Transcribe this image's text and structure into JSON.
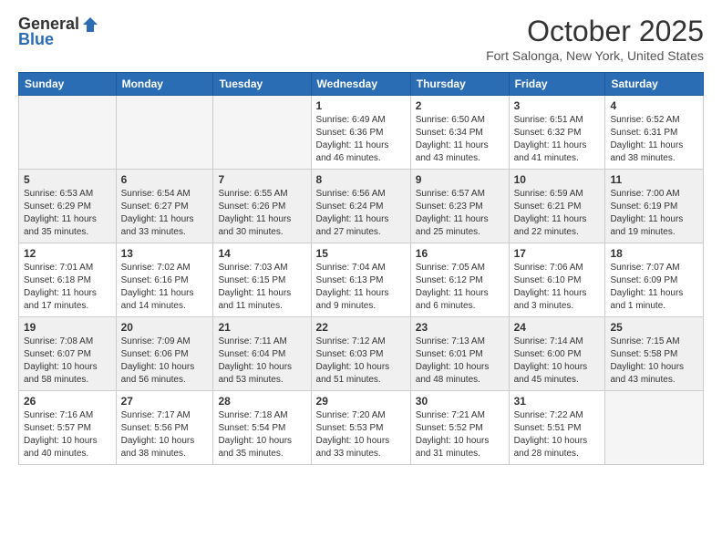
{
  "header": {
    "logo_line1": "General",
    "logo_line2": "Blue",
    "month": "October 2025",
    "location": "Fort Salonga, New York, United States"
  },
  "days_of_week": [
    "Sunday",
    "Monday",
    "Tuesday",
    "Wednesday",
    "Thursday",
    "Friday",
    "Saturday"
  ],
  "weeks": [
    [
      {
        "num": "",
        "info": ""
      },
      {
        "num": "",
        "info": ""
      },
      {
        "num": "",
        "info": ""
      },
      {
        "num": "1",
        "info": "Sunrise: 6:49 AM\nSunset: 6:36 PM\nDaylight: 11 hours\nand 46 minutes."
      },
      {
        "num": "2",
        "info": "Sunrise: 6:50 AM\nSunset: 6:34 PM\nDaylight: 11 hours\nand 43 minutes."
      },
      {
        "num": "3",
        "info": "Sunrise: 6:51 AM\nSunset: 6:32 PM\nDaylight: 11 hours\nand 41 minutes."
      },
      {
        "num": "4",
        "info": "Sunrise: 6:52 AM\nSunset: 6:31 PM\nDaylight: 11 hours\nand 38 minutes."
      }
    ],
    [
      {
        "num": "5",
        "info": "Sunrise: 6:53 AM\nSunset: 6:29 PM\nDaylight: 11 hours\nand 35 minutes."
      },
      {
        "num": "6",
        "info": "Sunrise: 6:54 AM\nSunset: 6:27 PM\nDaylight: 11 hours\nand 33 minutes."
      },
      {
        "num": "7",
        "info": "Sunrise: 6:55 AM\nSunset: 6:26 PM\nDaylight: 11 hours\nand 30 minutes."
      },
      {
        "num": "8",
        "info": "Sunrise: 6:56 AM\nSunset: 6:24 PM\nDaylight: 11 hours\nand 27 minutes."
      },
      {
        "num": "9",
        "info": "Sunrise: 6:57 AM\nSunset: 6:23 PM\nDaylight: 11 hours\nand 25 minutes."
      },
      {
        "num": "10",
        "info": "Sunrise: 6:59 AM\nSunset: 6:21 PM\nDaylight: 11 hours\nand 22 minutes."
      },
      {
        "num": "11",
        "info": "Sunrise: 7:00 AM\nSunset: 6:19 PM\nDaylight: 11 hours\nand 19 minutes."
      }
    ],
    [
      {
        "num": "12",
        "info": "Sunrise: 7:01 AM\nSunset: 6:18 PM\nDaylight: 11 hours\nand 17 minutes."
      },
      {
        "num": "13",
        "info": "Sunrise: 7:02 AM\nSunset: 6:16 PM\nDaylight: 11 hours\nand 14 minutes."
      },
      {
        "num": "14",
        "info": "Sunrise: 7:03 AM\nSunset: 6:15 PM\nDaylight: 11 hours\nand 11 minutes."
      },
      {
        "num": "15",
        "info": "Sunrise: 7:04 AM\nSunset: 6:13 PM\nDaylight: 11 hours\nand 9 minutes."
      },
      {
        "num": "16",
        "info": "Sunrise: 7:05 AM\nSunset: 6:12 PM\nDaylight: 11 hours\nand 6 minutes."
      },
      {
        "num": "17",
        "info": "Sunrise: 7:06 AM\nSunset: 6:10 PM\nDaylight: 11 hours\nand 3 minutes."
      },
      {
        "num": "18",
        "info": "Sunrise: 7:07 AM\nSunset: 6:09 PM\nDaylight: 11 hours\nand 1 minute."
      }
    ],
    [
      {
        "num": "19",
        "info": "Sunrise: 7:08 AM\nSunset: 6:07 PM\nDaylight: 10 hours\nand 58 minutes."
      },
      {
        "num": "20",
        "info": "Sunrise: 7:09 AM\nSunset: 6:06 PM\nDaylight: 10 hours\nand 56 minutes."
      },
      {
        "num": "21",
        "info": "Sunrise: 7:11 AM\nSunset: 6:04 PM\nDaylight: 10 hours\nand 53 minutes."
      },
      {
        "num": "22",
        "info": "Sunrise: 7:12 AM\nSunset: 6:03 PM\nDaylight: 10 hours\nand 51 minutes."
      },
      {
        "num": "23",
        "info": "Sunrise: 7:13 AM\nSunset: 6:01 PM\nDaylight: 10 hours\nand 48 minutes."
      },
      {
        "num": "24",
        "info": "Sunrise: 7:14 AM\nSunset: 6:00 PM\nDaylight: 10 hours\nand 45 minutes."
      },
      {
        "num": "25",
        "info": "Sunrise: 7:15 AM\nSunset: 5:58 PM\nDaylight: 10 hours\nand 43 minutes."
      }
    ],
    [
      {
        "num": "26",
        "info": "Sunrise: 7:16 AM\nSunset: 5:57 PM\nDaylight: 10 hours\nand 40 minutes."
      },
      {
        "num": "27",
        "info": "Sunrise: 7:17 AM\nSunset: 5:56 PM\nDaylight: 10 hours\nand 38 minutes."
      },
      {
        "num": "28",
        "info": "Sunrise: 7:18 AM\nSunset: 5:54 PM\nDaylight: 10 hours\nand 35 minutes."
      },
      {
        "num": "29",
        "info": "Sunrise: 7:20 AM\nSunset: 5:53 PM\nDaylight: 10 hours\nand 33 minutes."
      },
      {
        "num": "30",
        "info": "Sunrise: 7:21 AM\nSunset: 5:52 PM\nDaylight: 10 hours\nand 31 minutes."
      },
      {
        "num": "31",
        "info": "Sunrise: 7:22 AM\nSunset: 5:51 PM\nDaylight: 10 hours\nand 28 minutes."
      },
      {
        "num": "",
        "info": ""
      }
    ]
  ]
}
